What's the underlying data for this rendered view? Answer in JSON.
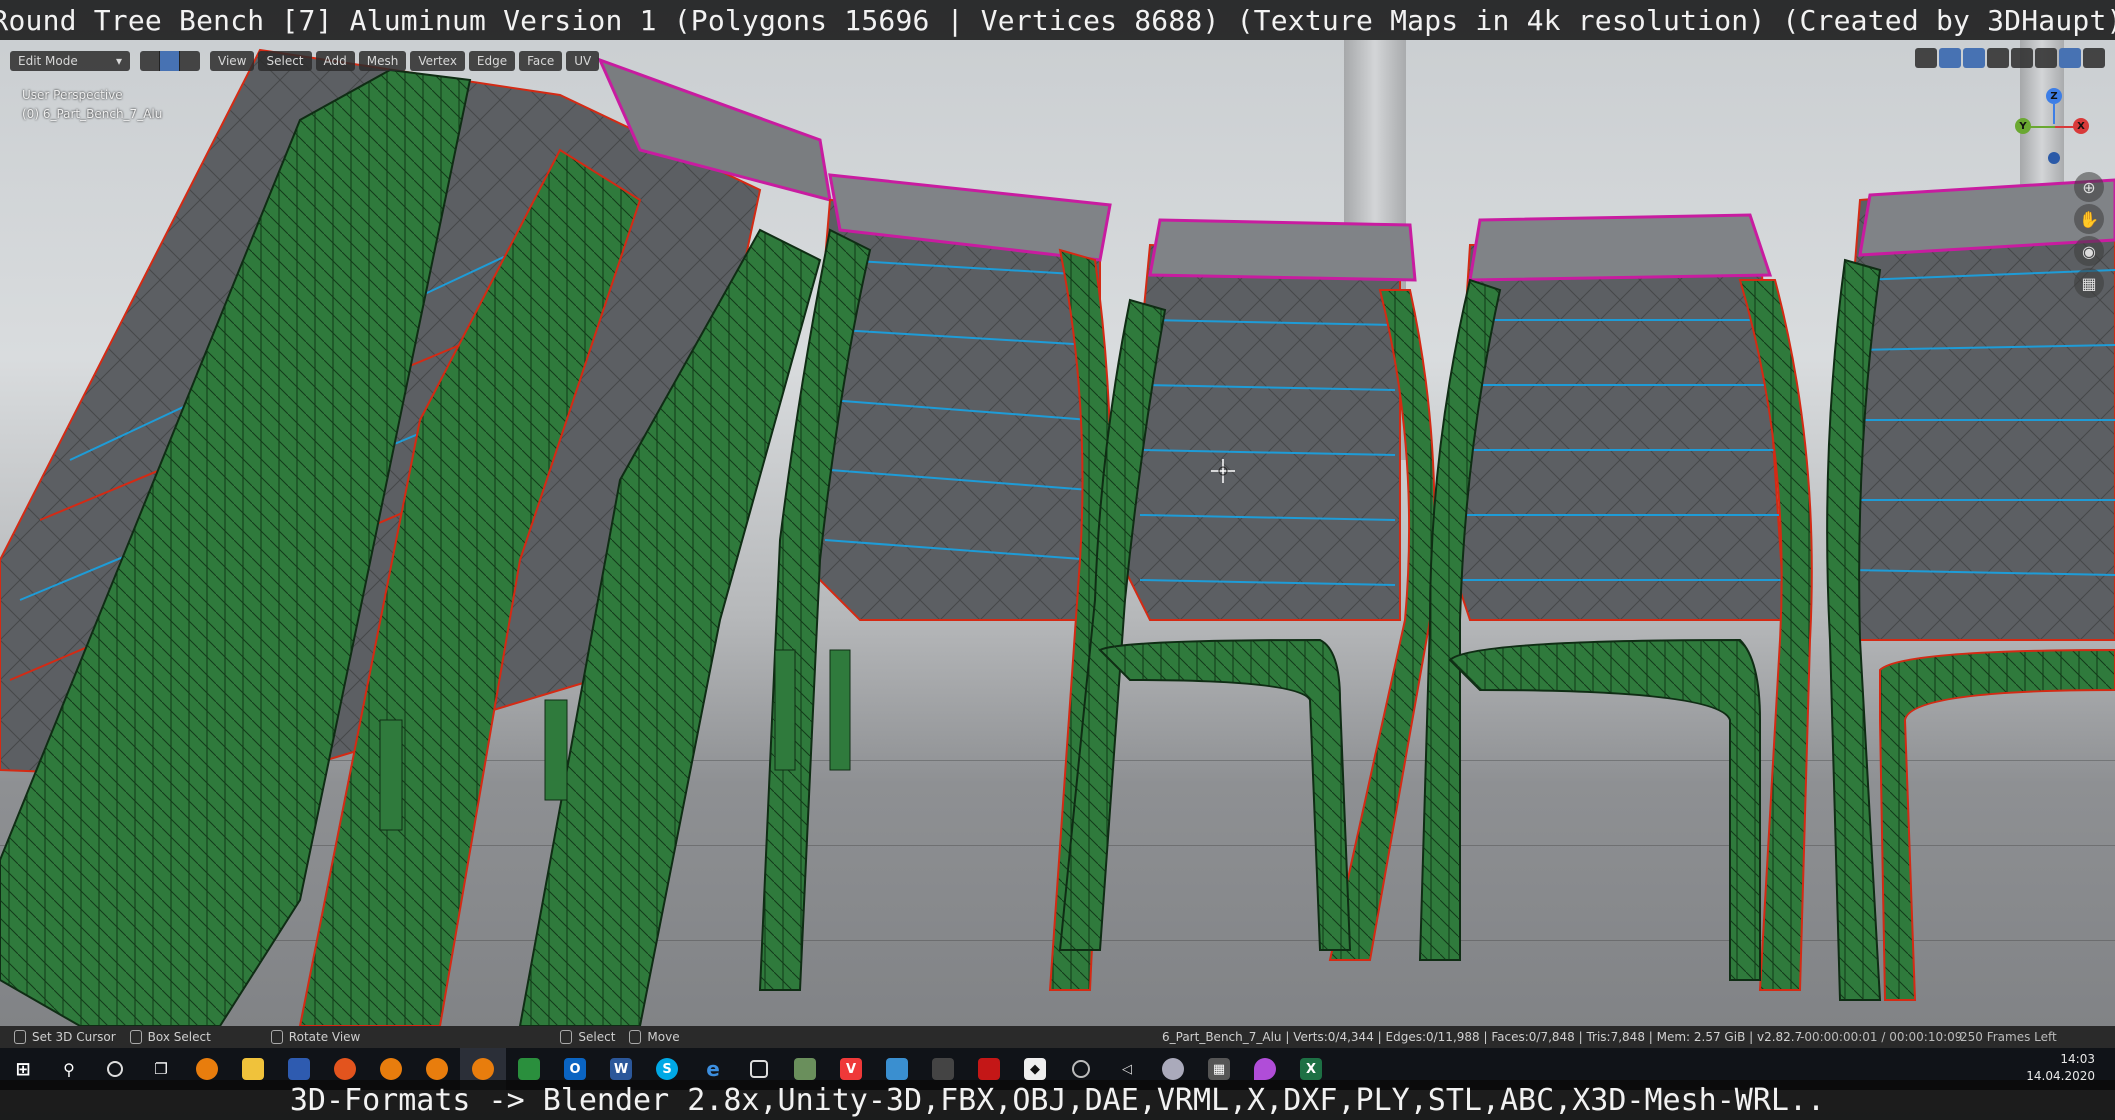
{
  "video": {
    "title": "Round Tree Bench [7] Aluminum Version 1 (Polygons 15696 | Vertices 8688) (Texture Maps in 4k resolution) (Created by 3DHaupt)",
    "subtitle": "3D-Formats -> Blender 2.8x,Unity-3D,FBX,OBJ,DAE,VRML,X,DXF,PLY,STL,ABC,X3D-Mesh-WRL.."
  },
  "header": {
    "mode": "Edit Mode",
    "menus": [
      "View",
      "Select",
      "Add",
      "Mesh",
      "Vertex",
      "Edge",
      "Face",
      "UV"
    ]
  },
  "viewport": {
    "perspective": "User Perspective",
    "object": "(0) 6_Part_Bench_7_Alu"
  },
  "gizmo": {
    "z": "Z",
    "y": "Y",
    "x": "X"
  },
  "status": {
    "left_items": [
      "Set 3D Cursor",
      "Box Select",
      "Rotate View",
      "Select",
      "Move"
    ],
    "stats": "6_Part_Bench_7_Alu | Verts:0/4,344 | Edges:0/11,988 | Faces:0/7,848 | Tris:7,848 | Mem: 2.57 GiB | v2.82.7",
    "time": "-00:00:00:01 / 00:00:10:09",
    "frames": "250 Frames Left"
  },
  "taskbar": {
    "icons": [
      "windows-start",
      "search",
      "cortana",
      "task-view",
      "blender",
      "file-explorer",
      "save",
      "firefox",
      "blender-2",
      "blender-3",
      "blender-4",
      "sheet",
      "outlook",
      "word",
      "skype",
      "edge",
      "box3d",
      "paint",
      "vivaldi",
      "photo",
      "app-a",
      "acrobat",
      "unity",
      "app-b",
      "app-c",
      "app-d",
      "calculator",
      "maps",
      "excel"
    ],
    "time": "14:03",
    "date": "14.04.2020"
  },
  "colors": {
    "mesh_green": "#2e7d3d",
    "seam_red": "#d42a14",
    "edge_blue": "#1e9cd7",
    "sharp_magenta": "#c81ca0",
    "slat_gray": "#5a5d61"
  }
}
